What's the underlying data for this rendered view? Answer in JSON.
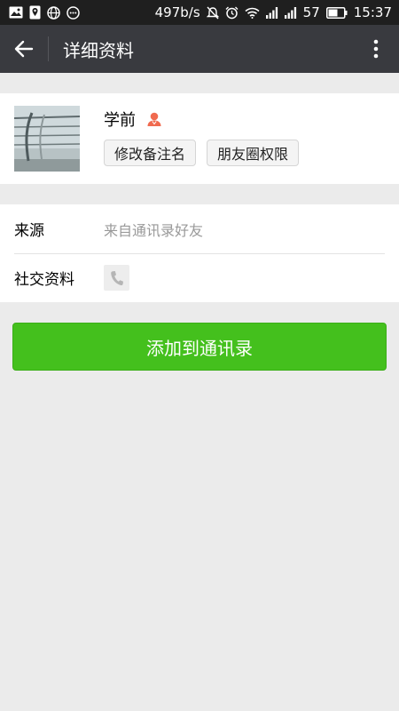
{
  "status_bar": {
    "net_speed": "497b/s",
    "battery": "57",
    "time": "15:37"
  },
  "app_bar": {
    "title": "详细资料"
  },
  "profile": {
    "name": "学前",
    "buttons": {
      "edit_remark": "修改备注名",
      "moments_permission": "朋友圈权限"
    }
  },
  "info": {
    "source_label": "来源",
    "source_value": "来自通讯录好友",
    "social_label": "社交资料"
  },
  "actions": {
    "add_to_contacts": "添加到通讯录"
  },
  "colors": {
    "status_bar_bg": "#1f1f1f",
    "app_bar_bg": "#393a3f",
    "page_bg": "#ebebeb",
    "primary_green": "#44c01d",
    "user_icon": "#f06a4f"
  }
}
